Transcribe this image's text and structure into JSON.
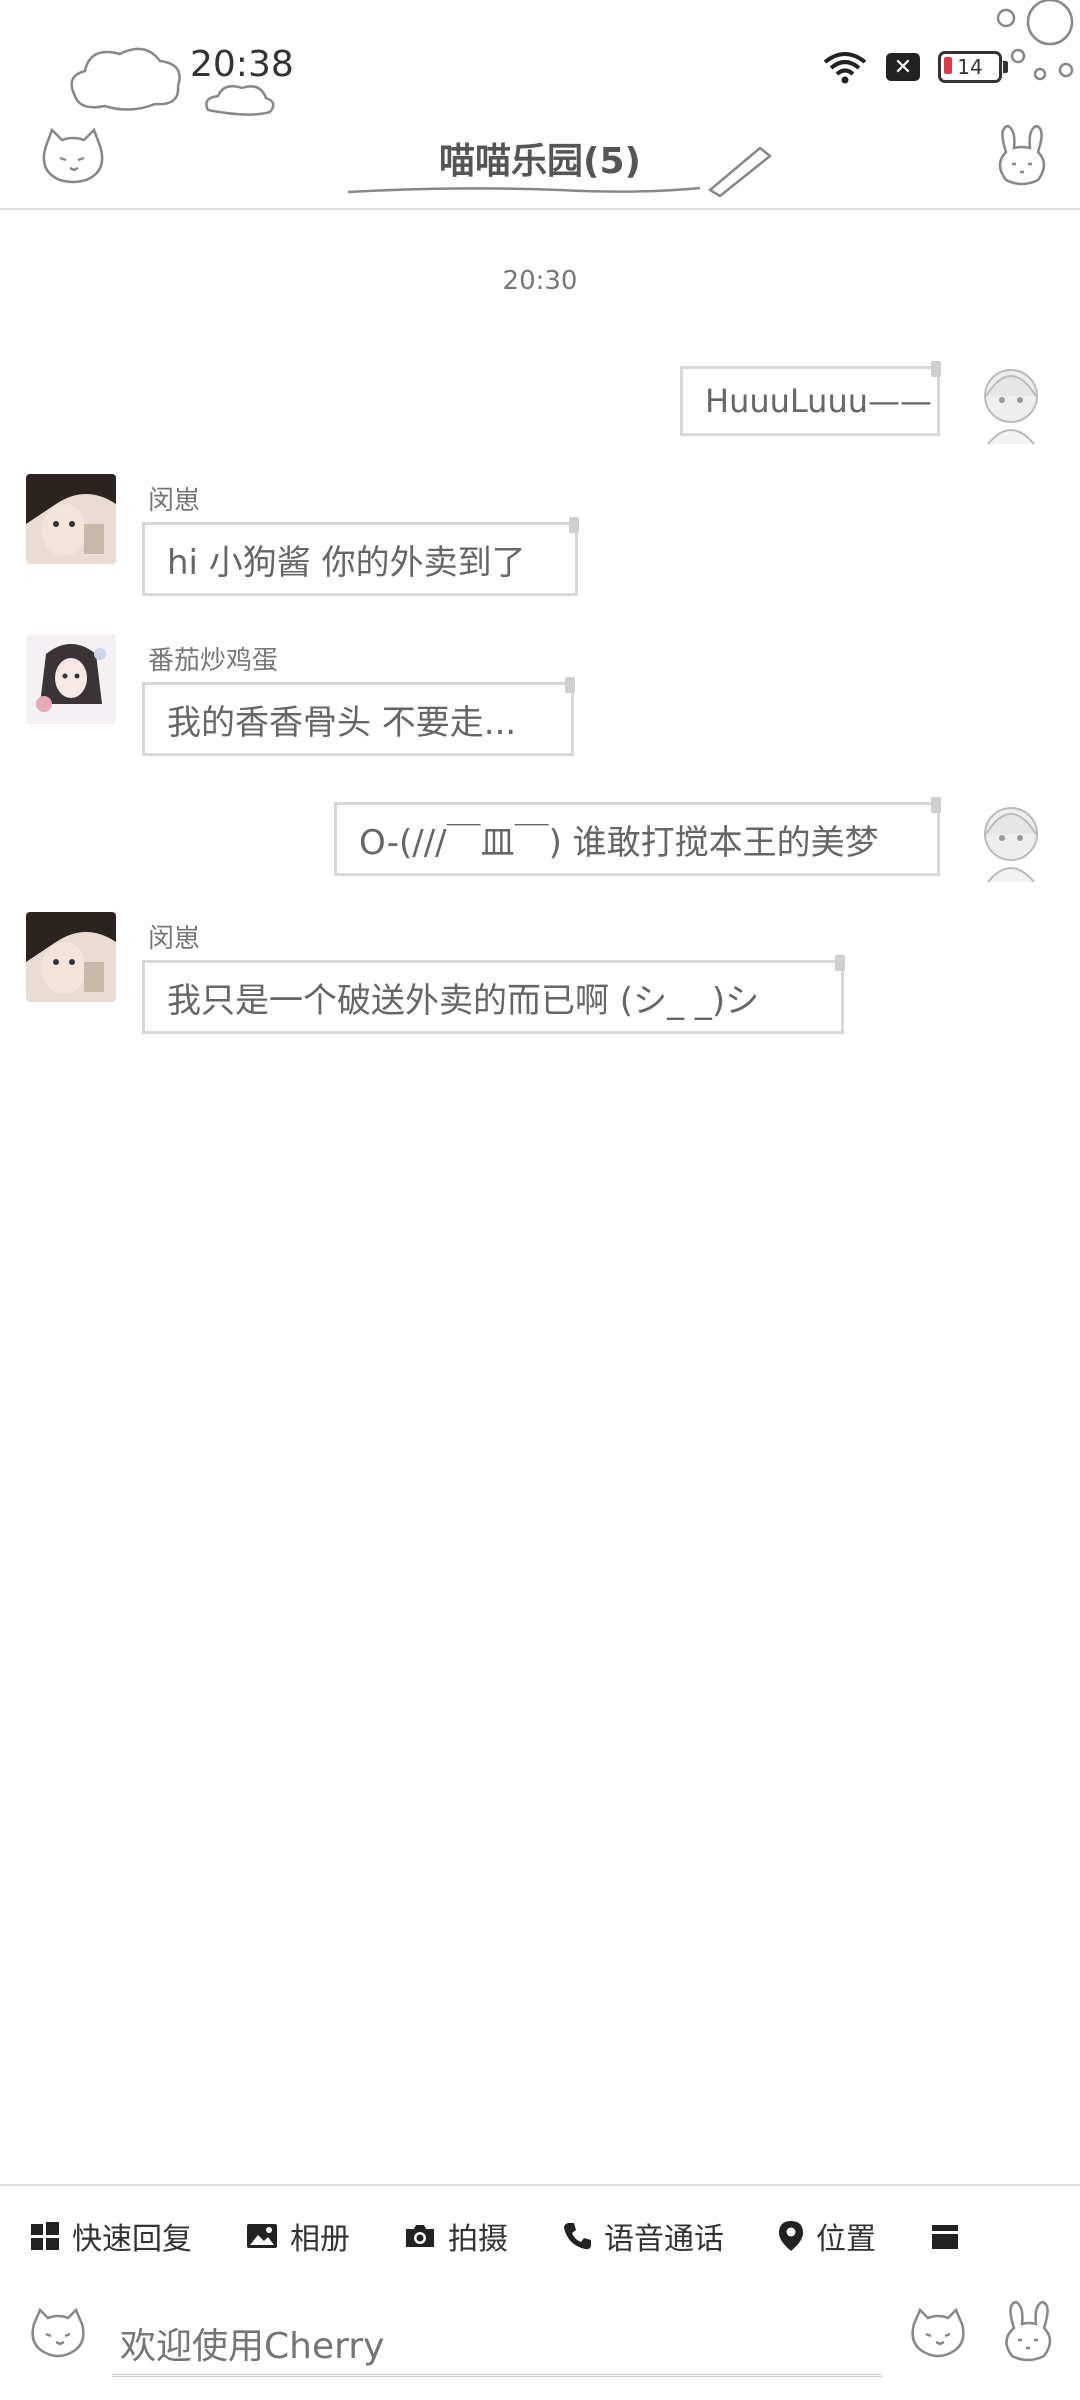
{
  "status_bar": {
    "time": "20:38",
    "battery": "14"
  },
  "header": {
    "title": "喵喵乐园(5)"
  },
  "chat": {
    "timestamp": "20:30",
    "messages": [
      {
        "side": "right",
        "sender": "",
        "text": "HuuuLuuu——"
      },
      {
        "side": "left",
        "sender": "闵崽",
        "text": "hi 小狗酱 你的外卖到了"
      },
      {
        "side": "left",
        "sender": "番茄炒鸡蛋",
        "text": "我的香香骨头 不要走..."
      },
      {
        "side": "right",
        "sender": "",
        "text": "O-(///￣皿￣) 谁敢打搅本王的美梦"
      },
      {
        "side": "left",
        "sender": "闵崽",
        "text": "我只是一个破送外卖的而已啊 (シ_ _)シ"
      }
    ]
  },
  "toolbar": {
    "items": [
      {
        "label": "快速回复",
        "icon": "grid-icon"
      },
      {
        "label": "相册",
        "icon": "image-icon"
      },
      {
        "label": "拍摄",
        "icon": "camera-icon"
      },
      {
        "label": "语音通话",
        "icon": "phone-icon"
      },
      {
        "label": "位置",
        "icon": "location-pin-icon"
      }
    ]
  },
  "input": {
    "placeholder": "欢迎使用Cherry"
  }
}
